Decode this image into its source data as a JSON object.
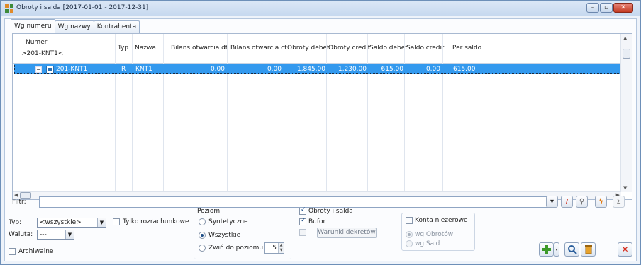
{
  "window": {
    "title": "Obroty i salda [2017-01-01 - 2017-12-31]",
    "controls": [
      "minimize-icon",
      "restore-icon",
      "close-icon"
    ]
  },
  "tabs": [
    {
      "label": "Wg numeru",
      "active": true
    },
    {
      "label": "Wg nazwy",
      "active": false
    },
    {
      "label": "Kontrahenta",
      "active": false
    }
  ],
  "grid": {
    "headers": {
      "numer": "Numer",
      "numer_filter": ">201-KNT1<",
      "typ": "Typ",
      "nazwa": "Nazwa",
      "bilans_dt": "Bilans otwarcia dt",
      "bilans_ct": "Bilans otwarcia ct",
      "obroty_debet": "Obroty debet",
      "obroty_credit": "Obroty credit",
      "saldo_debet": "Saldo debet",
      "saldo_credit": "Saldo credit",
      "per_saldo": "Per saldo"
    },
    "rows": [
      {
        "numer": "201-KNT1",
        "typ": "R",
        "nazwa": "KNT1",
        "bilans_dt": "0.00",
        "bilans_ct": "0.00",
        "obroty_debet": "1,845.00",
        "obroty_credit": "1,230.00",
        "saldo_debet": "615.00",
        "saldo_credit": "0.00",
        "per_saldo": "615.00",
        "selected": true
      }
    ]
  },
  "filter": {
    "label": "Filtr:",
    "value": ""
  },
  "options": {
    "typ_label": "Typ:",
    "typ_value": "<wszystkie>",
    "waluta_label": "Waluta:",
    "waluta_value": "---",
    "tylko_rozrachunkowe": "Tylko rozrachunkowe",
    "archiwalne": "Archiwalne",
    "poziom_label": "Poziom",
    "syntetyczne": "Syntetyczne",
    "wszystkie": "Wszystkie",
    "zwin": "Zwiń do poziomu",
    "zwin_value": "5",
    "obroty_i_salda": "Obroty i salda",
    "bufor": "Bufor",
    "warunki_dekretow": "Warunki dekretów",
    "konta_niezerowe": "Konta niezerowe",
    "wg_obrotow": "wg Obrotów",
    "wg_sald": "wg Sald"
  },
  "colors": {
    "selection": "#3399ee",
    "accent": "#1d4d86"
  }
}
